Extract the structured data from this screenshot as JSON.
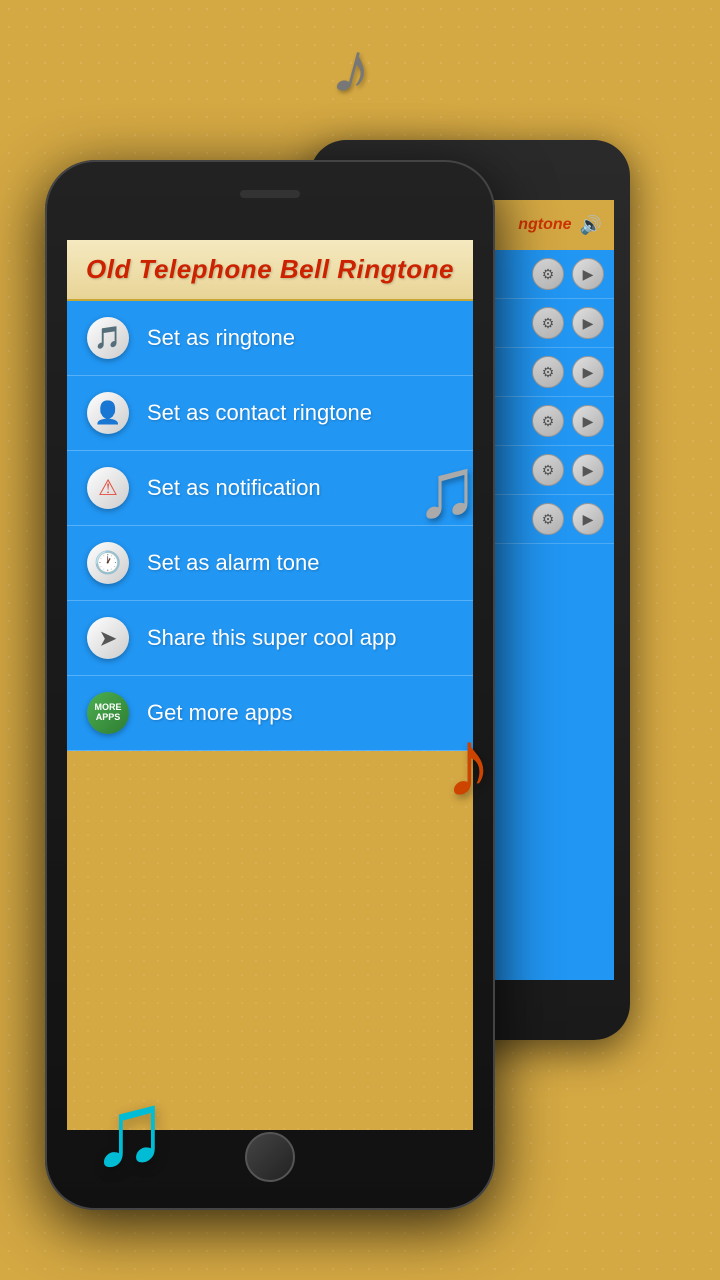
{
  "background": {
    "color": "#d4a843"
  },
  "app": {
    "title": "Old Telephone Bell Ringtone"
  },
  "menu": {
    "items": [
      {
        "id": "ringtone",
        "label": "Set as ringtone",
        "icon": "🎵",
        "icon_name": "music-note-icon"
      },
      {
        "id": "contact-ringtone",
        "label": "Set as contact ringtone",
        "icon": "👤",
        "icon_name": "contact-icon"
      },
      {
        "id": "notification",
        "label": "Set as notification",
        "icon": "⚠️",
        "icon_name": "notification-icon"
      },
      {
        "id": "alarm",
        "label": "Set as alarm tone",
        "icon": "🕐",
        "icon_name": "alarm-icon"
      },
      {
        "id": "share",
        "label": "Share this super cool app",
        "icon": "↗",
        "icon_name": "share-icon"
      },
      {
        "id": "more-apps",
        "label": "Get more apps",
        "icon": "📦",
        "icon_name": "more-apps-icon"
      }
    ]
  },
  "bg_phone": {
    "header_text": "ngtone",
    "rows_count": 6
  },
  "notes": {
    "top": "♪",
    "silver": "♫",
    "red": "♪",
    "blue": "♫"
  }
}
